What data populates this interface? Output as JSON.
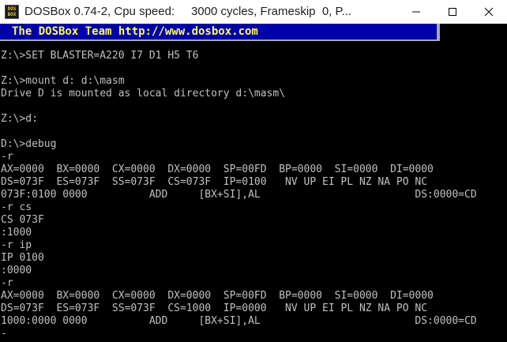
{
  "window": {
    "title": "DOSBox 0.74-2, Cpu speed:     3000 cycles, Frameskip  0, P...",
    "icon_text_top": "DOS",
    "icon_text_bottom": "BOX"
  },
  "banner": {
    "text": "The DOSBox Team http://www.dosbox.com"
  },
  "console": {
    "lines": [
      "Z:\\>SET BLASTER=A220 I7 D1 H5 T6",
      "",
      "Z:\\>mount d: d:\\masm",
      "Drive D is mounted as local directory d:\\masm\\",
      "",
      "Z:\\>d:",
      "",
      "D:\\>debug",
      "-r",
      "AX=0000  BX=0000  CX=0000  DX=0000  SP=00FD  BP=0000  SI=0000  DI=0000",
      "DS=073F  ES=073F  SS=073F  CS=073F  IP=0100   NV UP EI PL NZ NA PO NC",
      "073F:0100 0000          ADD     [BX+SI],AL                         DS:0000=CD",
      "-r cs",
      "CS 073F",
      ":1000",
      "-r ip",
      "IP 0100",
      ":0000",
      "-r",
      "AX=0000  BX=0000  CX=0000  DX=0000  SP=00FD  BP=0000  SI=0000  DI=0000",
      "DS=073F  ES=073F  SS=073F  CS=1000  IP=0000   NV UP EI PL NZ NA PO NC",
      "1000:0000 0000          ADD     [BX+SI],AL                         DS:0000=CD"
    ],
    "partial_line": "-"
  },
  "colors": {
    "banner_bg": "#0000a8",
    "banner_text": "#ffff55",
    "console_text": "#c0c0c0",
    "console_bg": "#000000"
  }
}
